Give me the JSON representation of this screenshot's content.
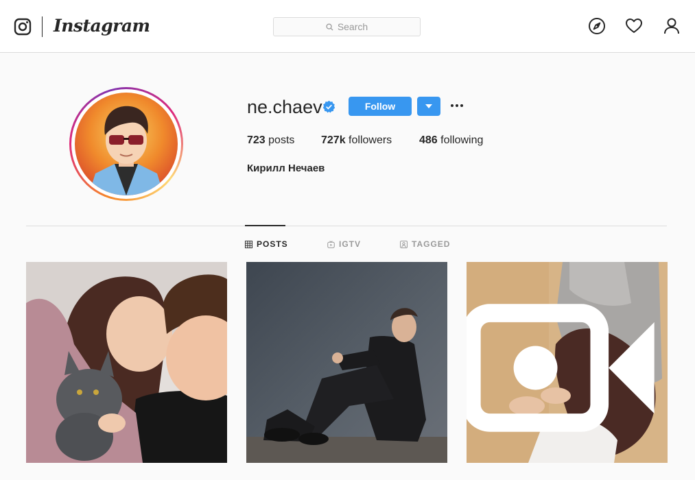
{
  "header": {
    "brand": "Instagram",
    "search_placeholder": "Search",
    "nav_icons": [
      "compass-icon",
      "heart-icon",
      "user-icon"
    ]
  },
  "profile": {
    "username": "ne.chaev",
    "verified": true,
    "follow_label": "Follow",
    "full_name": "Кирилл Нечаев",
    "stats": {
      "posts_count": "723",
      "posts_label": " posts",
      "followers_count": "727k",
      "followers_label": " followers",
      "following_count": "486",
      "following_label": " following"
    }
  },
  "tabs": [
    {
      "label": "POSTS",
      "icon": "grid-icon",
      "active": true
    },
    {
      "label": "IGTV",
      "icon": "igtv-icon",
      "active": false
    },
    {
      "label": "TAGGED",
      "icon": "tagged-icon",
      "active": false
    }
  ],
  "colors": {
    "accent": "#3897f0",
    "verified": "#3897f0",
    "border": "#dbdbdb"
  },
  "posts": [
    {
      "type": "photo"
    },
    {
      "type": "photo"
    },
    {
      "type": "video"
    }
  ]
}
